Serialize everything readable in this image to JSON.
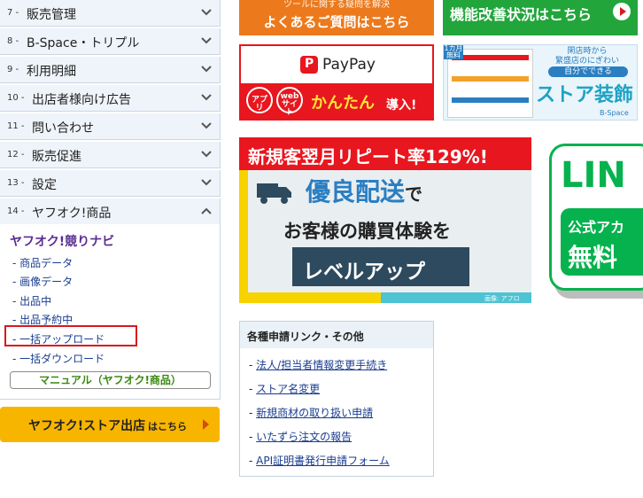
{
  "sidebar": {
    "items": [
      {
        "num": "7 -",
        "label": "販売管理",
        "expanded": false
      },
      {
        "num": "8 -",
        "label": "B-Space・トリプル",
        "expanded": false
      },
      {
        "num": "9 -",
        "label": "利用明細",
        "expanded": false
      },
      {
        "num": "10 -",
        "label": "出店者様向け広告",
        "expanded": false
      },
      {
        "num": "11 -",
        "label": "問い合わせ",
        "expanded": false
      },
      {
        "num": "12 -",
        "label": "販売促進",
        "expanded": false
      },
      {
        "num": "13 -",
        "label": "設定",
        "expanded": false
      },
      {
        "num": "14 -",
        "label": "ヤフオク!商品",
        "expanded": true
      }
    ],
    "submenu": {
      "title": "ヤフオク!競りナビ",
      "items": [
        "- 商品データ",
        "- 画像データ",
        "- 出品中",
        "- 出品予約中",
        "- 一括アップロード",
        "- 一括ダウンロード"
      ],
      "highlighted_index": 4,
      "manual_button": "マニュアル（ヤフオク!商品）"
    },
    "store_button": {
      "main": "ヤフオク!ストア出店",
      "suffix": "はこちら"
    }
  },
  "banners": {
    "faq": {
      "sub": "ツールに関する疑問を解決",
      "main": "よくあるご質問はこちら"
    },
    "improvement": {
      "main": "機能改善状況はこちら"
    },
    "paypay": {
      "logo": "PayPay",
      "bubble1": "アプリ",
      "bubble2": "web サイト",
      "easy": "かんたん",
      "intro": "導入!"
    },
    "decor": {
      "badge": "1カ月 無料",
      "line1": "閑店時から",
      "line2": "繁盛店のにぎわい",
      "pill": "自分でできる",
      "big": "ストア装飾",
      "brand": "B-Space"
    },
    "repeat": {
      "top": "新規客翌月リピート率129%!",
      "h1a": "優良配送",
      "h1b": "で",
      "h2": "お客様の購買体験を",
      "level": "レベルアップ",
      "credit": "画像: アフロ"
    },
    "line": {
      "word": "LIN",
      "g1": "公式アカ",
      "g2": "無料"
    }
  },
  "links": {
    "header": "各種申請リンク・その他",
    "items": [
      "法人/担当者情報変更手続き",
      "ストア名変更",
      "新規商材の取り扱い申請",
      "いたずら注文の報告",
      "API証明書発行申請フォーム"
    ]
  },
  "colors": {
    "accent": "#e8161e",
    "sidebar_bg": "#eff4fa",
    "link": "#1a3d8f",
    "line_green": "#06b24d",
    "store_btn": "#f8b500"
  }
}
